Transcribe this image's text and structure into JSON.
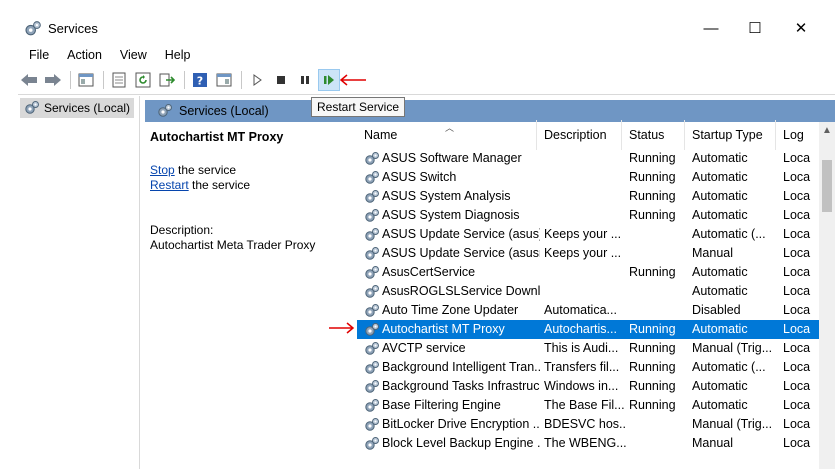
{
  "window": {
    "title": "Services",
    "minimize_glyph": "—",
    "maximize_glyph": "☐",
    "close_glyph": "✕"
  },
  "menu": {
    "items": [
      {
        "label": "File"
      },
      {
        "label": "Action"
      },
      {
        "label": "View"
      },
      {
        "label": "Help"
      }
    ]
  },
  "toolbar": {
    "icons": [
      "back-arrow-icon",
      "forward-arrow-icon",
      "show-hide-console-tree-icon",
      "properties-icon",
      "refresh-icon",
      "export-list-icon",
      "help-icon",
      "show-hide-action-pane-icon",
      "start-service-icon",
      "stop-service-icon",
      "pause-service-icon",
      "restart-service-icon"
    ],
    "tooltip": "Restart Service",
    "annotation_color": "#e00000"
  },
  "tree": {
    "selected_label": "Services (Local)"
  },
  "pane": {
    "header": "Services (Local)",
    "header_color": "#6f96c4"
  },
  "details": {
    "service_name": "Autochartist MT Proxy",
    "stop_link": "Stop",
    "stop_suffix": " the service",
    "restart_link": "Restart",
    "restart_suffix": " the service",
    "description_label": "Description:",
    "description_value": "Autochartist Meta Trader Proxy"
  },
  "table": {
    "columns": {
      "name": "Name",
      "description": "Description",
      "status": "Status",
      "startup": "Startup Type",
      "log": "Log"
    },
    "selection_color": "#0078d7",
    "rows": [
      {
        "name": "ASUS Software Manager",
        "description": "",
        "status": "Running",
        "startup": "Automatic",
        "log": "Loca"
      },
      {
        "name": "ASUS Switch",
        "description": "",
        "status": "Running",
        "startup": "Automatic",
        "log": "Loca"
      },
      {
        "name": "ASUS System Analysis",
        "description": "",
        "status": "Running",
        "startup": "Automatic",
        "log": "Loca"
      },
      {
        "name": "ASUS System Diagnosis",
        "description": "",
        "status": "Running",
        "startup": "Automatic",
        "log": "Loca"
      },
      {
        "name": "ASUS Update Service (asus)",
        "description": "Keeps your ...",
        "status": "",
        "startup": "Automatic (...",
        "log": "Loca"
      },
      {
        "name": "ASUS Update Service (asusm)",
        "description": "Keeps your ...",
        "status": "",
        "startup": "Manual",
        "log": "Loca"
      },
      {
        "name": "AsusCertService",
        "description": "",
        "status": "Running",
        "startup": "Automatic",
        "log": "Loca"
      },
      {
        "name": "AsusROGLSLService Downl...",
        "description": "",
        "status": "",
        "startup": "Automatic",
        "log": "Loca"
      },
      {
        "name": "Auto Time Zone Updater",
        "description": "Automatica...",
        "status": "",
        "startup": "Disabled",
        "log": "Loca"
      },
      {
        "name": "Autochartist MT Proxy",
        "description": "Autochartis...",
        "status": "Running",
        "startup": "Automatic",
        "log": "Loca",
        "selected": true
      },
      {
        "name": "AVCTP service",
        "description": "This is Audi...",
        "status": "Running",
        "startup": "Manual (Trig...",
        "log": "Loca"
      },
      {
        "name": "Background Intelligent Tran...",
        "description": "Transfers fil...",
        "status": "Running",
        "startup": "Automatic (...",
        "log": "Loca"
      },
      {
        "name": "Background Tasks Infrastruc...",
        "description": "Windows in...",
        "status": "Running",
        "startup": "Automatic",
        "log": "Loca"
      },
      {
        "name": "Base Filtering Engine",
        "description": "The Base Fil...",
        "status": "Running",
        "startup": "Automatic",
        "log": "Loca"
      },
      {
        "name": "BitLocker Drive Encryption ...",
        "description": "BDESVC hos...",
        "status": "",
        "startup": "Manual (Trig...",
        "log": "Loca"
      },
      {
        "name": "Block Level Backup Engine ...",
        "description": "The WBENG...",
        "status": "",
        "startup": "Manual",
        "log": "Loca"
      }
    ]
  }
}
